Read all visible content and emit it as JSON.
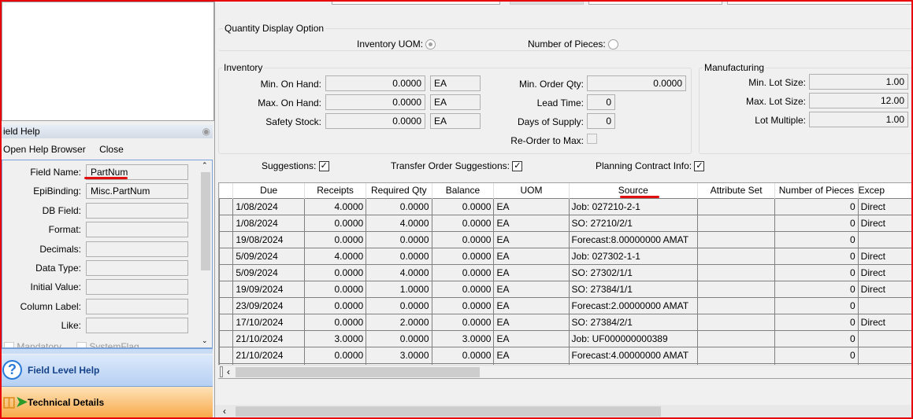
{
  "field_help": {
    "title": "ield Help",
    "open_browser": "Open Help Browser",
    "close": "Close",
    "fields": [
      {
        "label": "Field Name:",
        "value": "PartNum"
      },
      {
        "label": "EpiBinding:",
        "value": "Misc.PartNum"
      },
      {
        "label": "DB Field:",
        "value": ""
      },
      {
        "label": "Format:",
        "value": ""
      },
      {
        "label": "Decimals:",
        "value": ""
      },
      {
        "label": "Data Type:",
        "value": ""
      },
      {
        "label": "Initial Value:",
        "value": ""
      },
      {
        "label": "Column Label:",
        "value": ""
      },
      {
        "label": "Like:",
        "value": ""
      }
    ],
    "mandatory": "Mandatory",
    "system_flag": "SystemFlag",
    "nav": {
      "field_level_help": "Field Level Help",
      "technical_details": "Technical Details"
    }
  },
  "qty_display": {
    "title": "Quantity Display Option",
    "inventory_uom": "Inventory UOM:",
    "number_of_pieces": "Number of Pieces:",
    "selected": "inventory_uom"
  },
  "inventory": {
    "title": "Inventory",
    "min_on_hand": {
      "label": "Min. On Hand:",
      "value": "0.0000",
      "uom": "EA"
    },
    "max_on_hand": {
      "label": "Max. On Hand:",
      "value": "0.0000",
      "uom": "EA"
    },
    "safety_stock": {
      "label": "Safety Stock:",
      "value": "0.0000",
      "uom": "EA"
    },
    "min_order_qty": {
      "label": "Min. Order Qty:",
      "value": "0.0000"
    },
    "lead_time": {
      "label": "Lead Time:",
      "value": "0"
    },
    "days_of_supply": {
      "label": "Days of Supply:",
      "value": "0"
    },
    "reorder_to_max": {
      "label": "Re-Order to Max:",
      "checked": false
    }
  },
  "manufacturing": {
    "title": "Manufacturing",
    "min_lot": {
      "label": "Min. Lot Size:",
      "value": "1.00"
    },
    "max_lot": {
      "label": "Max. Lot Size:",
      "value": "12.00"
    },
    "lot_multiple": {
      "label": "Lot Multiple:",
      "value": "1.00"
    }
  },
  "options": {
    "suggestions": "Suggestions:",
    "transfer": "Transfer Order Suggestions:",
    "planning": "Planning Contract Info:"
  },
  "grid": {
    "columns": [
      "Due",
      "Receipts",
      "Required Qty",
      "Balance",
      "UOM",
      "Source",
      "Attribute Set",
      "Number of Pieces",
      "Excep"
    ],
    "rows": [
      [
        "1/08/2024",
        "4.0000",
        "0.0000",
        "0.0000",
        "EA",
        "Job: 027210-2-1",
        "",
        "0",
        "Direct"
      ],
      [
        "1/08/2024",
        "0.0000",
        "4.0000",
        "0.0000",
        "EA",
        "SO: 27210/2/1",
        "",
        "0",
        "Direct"
      ],
      [
        "19/08/2024",
        "0.0000",
        "0.0000",
        "0.0000",
        "EA",
        "Forecast:8.00000000 AMAT",
        "",
        "0",
        ""
      ],
      [
        "5/09/2024",
        "4.0000",
        "0.0000",
        "0.0000",
        "EA",
        "Job: 027302-1-1",
        "",
        "0",
        "Direct"
      ],
      [
        "5/09/2024",
        "0.0000",
        "4.0000",
        "0.0000",
        "EA",
        "SO: 27302/1/1",
        "",
        "0",
        "Direct"
      ],
      [
        "19/09/2024",
        "0.0000",
        "1.0000",
        "0.0000",
        "EA",
        "SO: 27384/1/1",
        "",
        "0",
        "Direct"
      ],
      [
        "23/09/2024",
        "0.0000",
        "0.0000",
        "0.0000",
        "EA",
        "Forecast:2.00000000 AMAT",
        "",
        "0",
        ""
      ],
      [
        "17/10/2024",
        "0.0000",
        "2.0000",
        "0.0000",
        "EA",
        "SO: 27384/2/1",
        "",
        "0",
        "Direct"
      ],
      [
        "21/10/2024",
        "3.0000",
        "0.0000",
        "3.0000",
        "EA",
        "Job: UF000000000389",
        "",
        "0",
        ""
      ],
      [
        "21/10/2024",
        "0.0000",
        "3.0000",
        "0.0000",
        "EA",
        "Forecast:4.00000000 AMAT",
        "",
        "0",
        ""
      ]
    ]
  },
  "colors": {
    "annotation_red": "#e8000a",
    "nav_blue": "#b9d3f5",
    "nav_orange": "#f9a94a"
  }
}
